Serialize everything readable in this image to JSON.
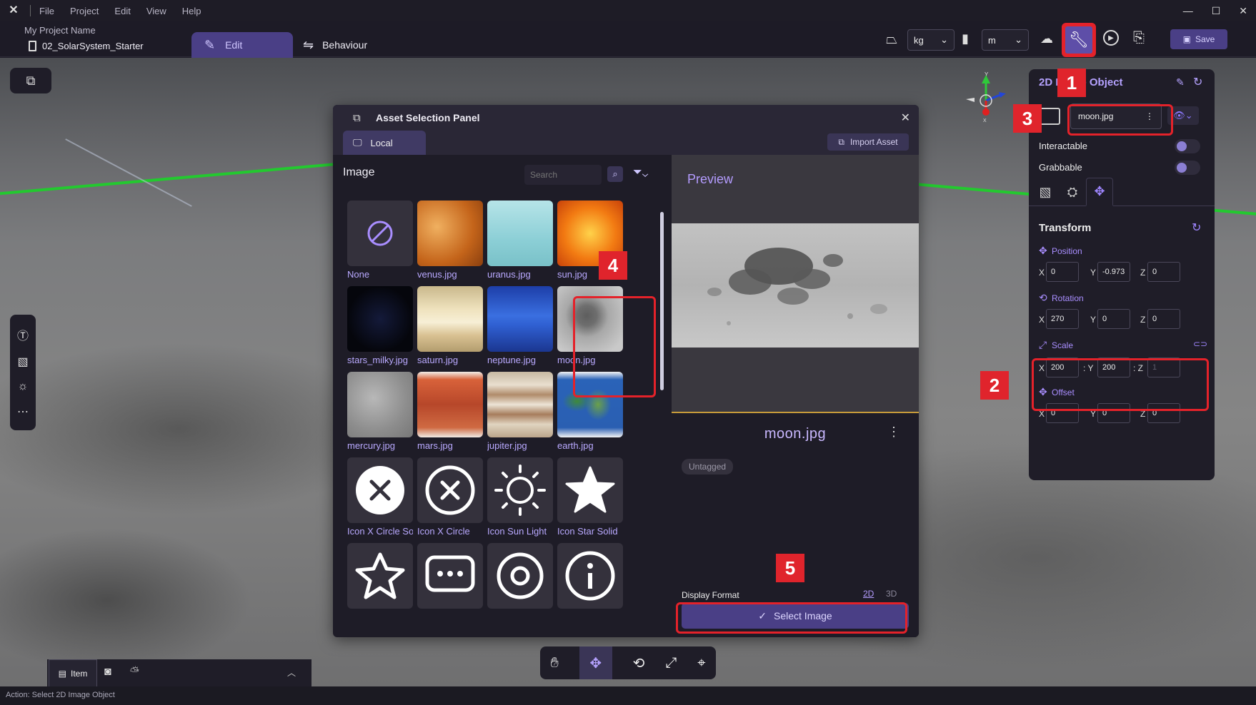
{
  "menu": {
    "items": [
      "File",
      "Project",
      "Edit",
      "View",
      "Help"
    ],
    "window_controls": [
      "—",
      "☐",
      "✕"
    ]
  },
  "project": {
    "name": "My Project Name",
    "scene": "02_SolarSystem_Starter"
  },
  "mode_tabs": {
    "edit": "Edit",
    "behaviour": "Behaviour"
  },
  "units": {
    "mass": "kg",
    "length": "m"
  },
  "toolbar": {
    "save_label": "Save"
  },
  "asset_panel": {
    "title": "Asset Selection Panel",
    "tab_local": "Local",
    "import_label": "Import Asset",
    "section_title": "Image",
    "search_placeholder": "Search",
    "assets": [
      {
        "label": "None",
        "thumb": "none"
      },
      {
        "label": "venus.jpg",
        "thumb": "venus"
      },
      {
        "label": "uranus.jpg",
        "thumb": "uranus"
      },
      {
        "label": "sun.jpg",
        "thumb": "sun"
      },
      {
        "label": "stars_milky.jpg",
        "thumb": "stars"
      },
      {
        "label": "saturn.jpg",
        "thumb": "saturn"
      },
      {
        "label": "neptune.jpg",
        "thumb": "neptune"
      },
      {
        "label": "moon.jpg",
        "thumb": "moon"
      },
      {
        "label": "mercury.jpg",
        "thumb": "mercury"
      },
      {
        "label": "mars.jpg",
        "thumb": "mars"
      },
      {
        "label": "jupiter.jpg",
        "thumb": "jupiter"
      },
      {
        "label": "earth.jpg",
        "thumb": "earth"
      },
      {
        "label": "Icon X Circle Solid",
        "thumb": "icon-x-solid"
      },
      {
        "label": "Icon X Circle",
        "thumb": "icon-x"
      },
      {
        "label": "Icon Sun Light",
        "thumb": "icon-sun"
      },
      {
        "label": "Icon Star Solid",
        "thumb": "icon-star-solid"
      },
      {
        "label": "",
        "thumb": "icon-star"
      },
      {
        "label": "",
        "thumb": "icon-chat"
      },
      {
        "label": "",
        "thumb": "icon-target"
      },
      {
        "label": "",
        "thumb": "icon-info"
      }
    ],
    "preview_label": "Preview",
    "preview_filename": "moon.jpg",
    "tag": "Untagged",
    "display_format_label": "Display Format",
    "format_2d": "2D",
    "format_3d": "3D",
    "select_button": "Select Image"
  },
  "inspector": {
    "title": "2D Image Object",
    "asset_value": "moon.jpg",
    "interactable_label": "Interactable",
    "grabbable_label": "Grabbable",
    "transform_title": "Transform",
    "position_label": "Position",
    "rotation_label": "Rotation",
    "scale_label": "Scale",
    "offset_label": "Offset",
    "position": {
      "x": "0",
      "y": "-0.973",
      "z": "0"
    },
    "rotation": {
      "x": "270",
      "y": "0",
      "z": "0"
    },
    "scale": {
      "x": "200",
      "y": "200",
      "z": "1"
    },
    "offset": {
      "x": "0",
      "y": "0",
      "z": "0"
    }
  },
  "dock": {
    "item_tab": "Item"
  },
  "status": {
    "action": "Action: Select 2D Image Object"
  },
  "callouts": [
    "1",
    "2",
    "3",
    "4",
    "5"
  ],
  "colors": {
    "accent": "#4a3f86",
    "highlight": "#e4222a",
    "link": "#b9a9ff"
  }
}
